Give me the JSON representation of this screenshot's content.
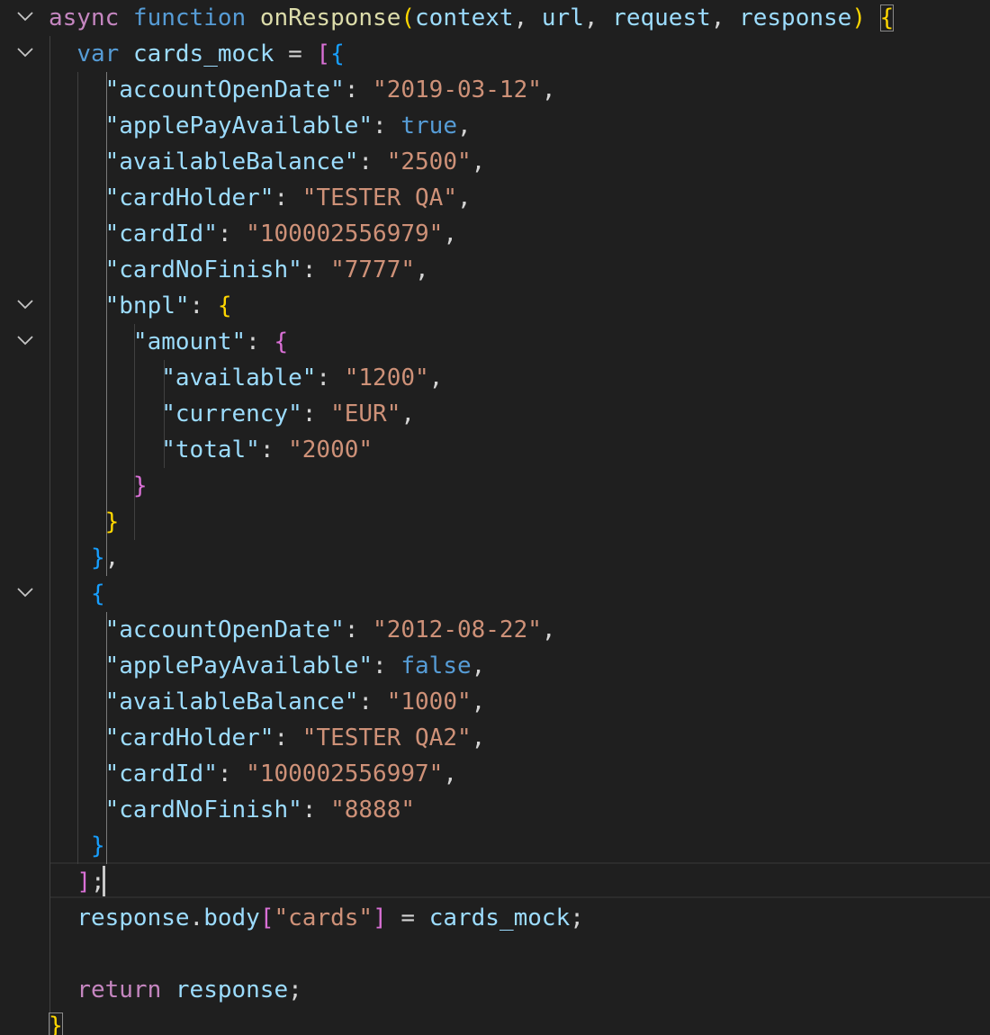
{
  "editor": {
    "theme_colors": {
      "background": "#1f1f1f",
      "keyword": "#569cd6",
      "control": "#c586c0",
      "function": "#dcdcaa",
      "variable": "#9cdcfe",
      "string": "#ce9178",
      "bracket_level1": "#ffd700",
      "bracket_level2": "#da70d6",
      "bracket_level3": "#179fff"
    },
    "cursor_line": 25,
    "lines": [
      {
        "fold": "chevron-down-icon",
        "tokens": [
          {
            "t": "async ",
            "c": "ctl"
          },
          {
            "t": "function ",
            "c": "kw"
          },
          {
            "t": "onResponse",
            "c": "fn"
          },
          {
            "t": "(",
            "c": "b1"
          },
          {
            "t": "context",
            "c": "var"
          },
          {
            "t": ", ",
            "c": "punc"
          },
          {
            "t": "url",
            "c": "var"
          },
          {
            "t": ", ",
            "c": "punc"
          },
          {
            "t": "request",
            "c": "var"
          },
          {
            "t": ", ",
            "c": "punc"
          },
          {
            "t": "response",
            "c": "var"
          },
          {
            "t": ") ",
            "c": "b1"
          },
          {
            "t": "{",
            "c": "b1",
            "match": true
          }
        ]
      },
      {
        "fold": "chevron-down-icon",
        "tokens": [
          {
            "t": "  ",
            "c": "punc"
          },
          {
            "t": "var ",
            "c": "kw"
          },
          {
            "t": "cards_mock",
            "c": "var"
          },
          {
            "t": " = ",
            "c": "punc"
          },
          {
            "t": "[",
            "c": "b2"
          },
          {
            "t": "{",
            "c": "b3"
          }
        ]
      },
      {
        "tokens": [
          {
            "t": "    ",
            "c": "punc"
          },
          {
            "t": "\"accountOpenDate\"",
            "c": "var"
          },
          {
            "t": ": ",
            "c": "punc"
          },
          {
            "t": "\"2019-03-12\"",
            "c": "str"
          },
          {
            "t": ",",
            "c": "punc"
          }
        ]
      },
      {
        "tokens": [
          {
            "t": "    ",
            "c": "punc"
          },
          {
            "t": "\"applePayAvailable\"",
            "c": "var"
          },
          {
            "t": ": ",
            "c": "punc"
          },
          {
            "t": "true",
            "c": "kw"
          },
          {
            "t": ",",
            "c": "punc"
          }
        ]
      },
      {
        "tokens": [
          {
            "t": "    ",
            "c": "punc"
          },
          {
            "t": "\"availableBalance\"",
            "c": "var"
          },
          {
            "t": ": ",
            "c": "punc"
          },
          {
            "t": "\"2500\"",
            "c": "str"
          },
          {
            "t": ",",
            "c": "punc"
          }
        ]
      },
      {
        "tokens": [
          {
            "t": "    ",
            "c": "punc"
          },
          {
            "t": "\"cardHolder\"",
            "c": "var"
          },
          {
            "t": ": ",
            "c": "punc"
          },
          {
            "t": "\"TESTER QA\"",
            "c": "str"
          },
          {
            "t": ",",
            "c": "punc"
          }
        ]
      },
      {
        "tokens": [
          {
            "t": "    ",
            "c": "punc"
          },
          {
            "t": "\"cardId\"",
            "c": "var"
          },
          {
            "t": ": ",
            "c": "punc"
          },
          {
            "t": "\"100002556979\"",
            "c": "str"
          },
          {
            "t": ",",
            "c": "punc"
          }
        ]
      },
      {
        "tokens": [
          {
            "t": "    ",
            "c": "punc"
          },
          {
            "t": "\"cardNoFinish\"",
            "c": "var"
          },
          {
            "t": ": ",
            "c": "punc"
          },
          {
            "t": "\"7777\"",
            "c": "str"
          },
          {
            "t": ",",
            "c": "punc"
          }
        ]
      },
      {
        "fold": "chevron-down-icon",
        "tokens": [
          {
            "t": "    ",
            "c": "punc"
          },
          {
            "t": "\"bnpl\"",
            "c": "var"
          },
          {
            "t": ": ",
            "c": "punc"
          },
          {
            "t": "{",
            "c": "b1"
          }
        ]
      },
      {
        "fold": "chevron-down-icon",
        "tokens": [
          {
            "t": "      ",
            "c": "punc"
          },
          {
            "t": "\"amount\"",
            "c": "var"
          },
          {
            "t": ": ",
            "c": "punc"
          },
          {
            "t": "{",
            "c": "b2"
          }
        ]
      },
      {
        "tokens": [
          {
            "t": "        ",
            "c": "punc"
          },
          {
            "t": "\"available\"",
            "c": "var"
          },
          {
            "t": ": ",
            "c": "punc"
          },
          {
            "t": "\"1200\"",
            "c": "str"
          },
          {
            "t": ",",
            "c": "punc"
          }
        ]
      },
      {
        "tokens": [
          {
            "t": "        ",
            "c": "punc"
          },
          {
            "t": "\"currency\"",
            "c": "var"
          },
          {
            "t": ": ",
            "c": "punc"
          },
          {
            "t": "\"EUR\"",
            "c": "str"
          },
          {
            "t": ",",
            "c": "punc"
          }
        ]
      },
      {
        "tokens": [
          {
            "t": "        ",
            "c": "punc"
          },
          {
            "t": "\"total\"",
            "c": "var"
          },
          {
            "t": ": ",
            "c": "punc"
          },
          {
            "t": "\"2000\"",
            "c": "str"
          }
        ]
      },
      {
        "tokens": [
          {
            "t": "      ",
            "c": "punc"
          },
          {
            "t": "}",
            "c": "b2"
          }
        ]
      },
      {
        "tokens": [
          {
            "t": "    ",
            "c": "punc"
          },
          {
            "t": "}",
            "c": "b1"
          }
        ]
      },
      {
        "tokens": [
          {
            "t": "   ",
            "c": "punc"
          },
          {
            "t": "}",
            "c": "b3"
          },
          {
            "t": ",",
            "c": "punc"
          }
        ]
      },
      {
        "fold": "chevron-down-icon",
        "tokens": [
          {
            "t": "   ",
            "c": "punc"
          },
          {
            "t": "{",
            "c": "b3"
          }
        ]
      },
      {
        "tokens": [
          {
            "t": "    ",
            "c": "punc"
          },
          {
            "t": "\"accountOpenDate\"",
            "c": "var"
          },
          {
            "t": ": ",
            "c": "punc"
          },
          {
            "t": "\"2012-08-22\"",
            "c": "str"
          },
          {
            "t": ",",
            "c": "punc"
          }
        ]
      },
      {
        "tokens": [
          {
            "t": "    ",
            "c": "punc"
          },
          {
            "t": "\"applePayAvailable\"",
            "c": "var"
          },
          {
            "t": ": ",
            "c": "punc"
          },
          {
            "t": "false",
            "c": "kw"
          },
          {
            "t": ",",
            "c": "punc"
          }
        ]
      },
      {
        "tokens": [
          {
            "t": "    ",
            "c": "punc"
          },
          {
            "t": "\"availableBalance\"",
            "c": "var"
          },
          {
            "t": ": ",
            "c": "punc"
          },
          {
            "t": "\"1000\"",
            "c": "str"
          },
          {
            "t": ",",
            "c": "punc"
          }
        ]
      },
      {
        "tokens": [
          {
            "t": "    ",
            "c": "punc"
          },
          {
            "t": "\"cardHolder\"",
            "c": "var"
          },
          {
            "t": ": ",
            "c": "punc"
          },
          {
            "t": "\"TESTER QA2\"",
            "c": "str"
          },
          {
            "t": ",",
            "c": "punc"
          }
        ]
      },
      {
        "tokens": [
          {
            "t": "    ",
            "c": "punc"
          },
          {
            "t": "\"cardId\"",
            "c": "var"
          },
          {
            "t": ": ",
            "c": "punc"
          },
          {
            "t": "\"100002556997\"",
            "c": "str"
          },
          {
            "t": ",",
            "c": "punc"
          }
        ]
      },
      {
        "tokens": [
          {
            "t": "    ",
            "c": "punc"
          },
          {
            "t": "\"cardNoFinish\"",
            "c": "var"
          },
          {
            "t": ": ",
            "c": "punc"
          },
          {
            "t": "\"8888\"",
            "c": "str"
          }
        ]
      },
      {
        "tokens": [
          {
            "t": "   ",
            "c": "punc"
          },
          {
            "t": "}",
            "c": "b3"
          }
        ]
      },
      {
        "tokens": [
          {
            "t": "  ",
            "c": "punc"
          },
          {
            "t": "]",
            "c": "b2"
          },
          {
            "t": ";",
            "c": "punc"
          }
        ]
      },
      {
        "tokens": [
          {
            "t": "  ",
            "c": "punc"
          },
          {
            "t": "response",
            "c": "var"
          },
          {
            "t": ".",
            "c": "punc"
          },
          {
            "t": "body",
            "c": "var"
          },
          {
            "t": "[",
            "c": "b2"
          },
          {
            "t": "\"cards\"",
            "c": "str"
          },
          {
            "t": "]",
            "c": "b2"
          },
          {
            "t": " = ",
            "c": "punc"
          },
          {
            "t": "cards_mock",
            "c": "var"
          },
          {
            "t": ";",
            "c": "punc"
          }
        ]
      },
      {
        "tokens": []
      },
      {
        "tokens": [
          {
            "t": "  ",
            "c": "punc"
          },
          {
            "t": "return ",
            "c": "ctl"
          },
          {
            "t": "response",
            "c": "var"
          },
          {
            "t": ";",
            "c": "punc"
          }
        ]
      },
      {
        "tokens": [
          {
            "t": "}",
            "c": "b1",
            "match": true
          }
        ]
      }
    ]
  }
}
